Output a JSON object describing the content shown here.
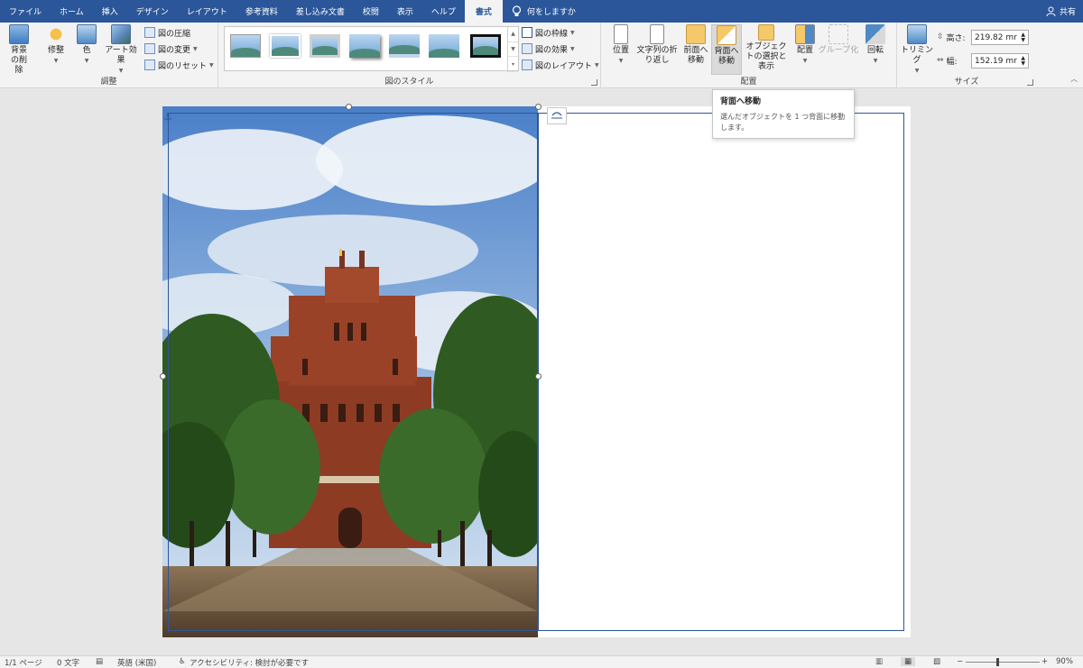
{
  "tabs": [
    "ファイル",
    "ホーム",
    "挿入",
    "デザイン",
    "レイアウト",
    "参考資料",
    "差し込み文書",
    "校閲",
    "表示",
    "ヘルプ",
    "書式"
  ],
  "active_tab": "書式",
  "tell_me": "何をしますか",
  "share": "共有",
  "ribbon": {
    "adjust": {
      "label": "調整",
      "remove_bg": "背景の削除",
      "corrections": "修整",
      "color": "色",
      "artistic": "アート効果",
      "compress": "図の圧縮",
      "change": "図の変更",
      "reset": "図のリセット"
    },
    "styles": {
      "label": "図のスタイル",
      "border": "図の枠線",
      "effects": "図の効果",
      "layout": "図のレイアウト"
    },
    "arrange": {
      "label": "配置",
      "position": "位置",
      "wrap": "文字列の折り返し",
      "forward": "前面へ移動",
      "backward": "背面へ移動",
      "selection_pane": "オブジェクトの選択と表示",
      "align": "配置",
      "group": "グループ化",
      "rotate": "回転"
    },
    "size": {
      "label": "サイズ",
      "crop": "トリミング",
      "height_label": "高さ:",
      "height_value": "219.82 mr",
      "width_label": "幅:",
      "width_value": "152.19 mr"
    }
  },
  "tooltip": {
    "title": "背面へ移動",
    "body": "選んだオブジェクトを 1 つ背面に移動します。"
  },
  "status": {
    "page": "1/1 ページ",
    "words": "0 文字",
    "language": "英語 (米国)",
    "accessibility": "アクセシビリティ: 検討が必要です",
    "zoom": "90%"
  },
  "colors": {
    "accent": "#2b579a",
    "selection": "#2f5597"
  }
}
